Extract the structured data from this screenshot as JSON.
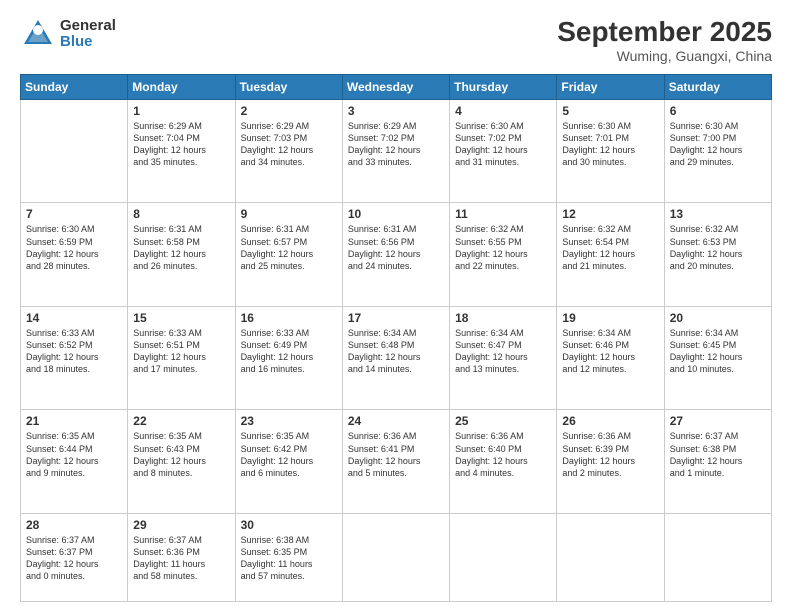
{
  "logo": {
    "general": "General",
    "blue": "Blue"
  },
  "title": {
    "month": "September 2025",
    "location": "Wuming, Guangxi, China"
  },
  "days": [
    "Sunday",
    "Monday",
    "Tuesday",
    "Wednesday",
    "Thursday",
    "Friday",
    "Saturday"
  ],
  "weeks": [
    [
      {
        "day": "",
        "info": ""
      },
      {
        "day": "1",
        "info": "Sunrise: 6:29 AM\nSunset: 7:04 PM\nDaylight: 12 hours\nand 35 minutes."
      },
      {
        "day": "2",
        "info": "Sunrise: 6:29 AM\nSunset: 7:03 PM\nDaylight: 12 hours\nand 34 minutes."
      },
      {
        "day": "3",
        "info": "Sunrise: 6:29 AM\nSunset: 7:02 PM\nDaylight: 12 hours\nand 33 minutes."
      },
      {
        "day": "4",
        "info": "Sunrise: 6:30 AM\nSunset: 7:02 PM\nDaylight: 12 hours\nand 31 minutes."
      },
      {
        "day": "5",
        "info": "Sunrise: 6:30 AM\nSunset: 7:01 PM\nDaylight: 12 hours\nand 30 minutes."
      },
      {
        "day": "6",
        "info": "Sunrise: 6:30 AM\nSunset: 7:00 PM\nDaylight: 12 hours\nand 29 minutes."
      }
    ],
    [
      {
        "day": "7",
        "info": "Sunrise: 6:30 AM\nSunset: 6:59 PM\nDaylight: 12 hours\nand 28 minutes."
      },
      {
        "day": "8",
        "info": "Sunrise: 6:31 AM\nSunset: 6:58 PM\nDaylight: 12 hours\nand 26 minutes."
      },
      {
        "day": "9",
        "info": "Sunrise: 6:31 AM\nSunset: 6:57 PM\nDaylight: 12 hours\nand 25 minutes."
      },
      {
        "day": "10",
        "info": "Sunrise: 6:31 AM\nSunset: 6:56 PM\nDaylight: 12 hours\nand 24 minutes."
      },
      {
        "day": "11",
        "info": "Sunrise: 6:32 AM\nSunset: 6:55 PM\nDaylight: 12 hours\nand 22 minutes."
      },
      {
        "day": "12",
        "info": "Sunrise: 6:32 AM\nSunset: 6:54 PM\nDaylight: 12 hours\nand 21 minutes."
      },
      {
        "day": "13",
        "info": "Sunrise: 6:32 AM\nSunset: 6:53 PM\nDaylight: 12 hours\nand 20 minutes."
      }
    ],
    [
      {
        "day": "14",
        "info": "Sunrise: 6:33 AM\nSunset: 6:52 PM\nDaylight: 12 hours\nand 18 minutes."
      },
      {
        "day": "15",
        "info": "Sunrise: 6:33 AM\nSunset: 6:51 PM\nDaylight: 12 hours\nand 17 minutes."
      },
      {
        "day": "16",
        "info": "Sunrise: 6:33 AM\nSunset: 6:49 PM\nDaylight: 12 hours\nand 16 minutes."
      },
      {
        "day": "17",
        "info": "Sunrise: 6:34 AM\nSunset: 6:48 PM\nDaylight: 12 hours\nand 14 minutes."
      },
      {
        "day": "18",
        "info": "Sunrise: 6:34 AM\nSunset: 6:47 PM\nDaylight: 12 hours\nand 13 minutes."
      },
      {
        "day": "19",
        "info": "Sunrise: 6:34 AM\nSunset: 6:46 PM\nDaylight: 12 hours\nand 12 minutes."
      },
      {
        "day": "20",
        "info": "Sunrise: 6:34 AM\nSunset: 6:45 PM\nDaylight: 12 hours\nand 10 minutes."
      }
    ],
    [
      {
        "day": "21",
        "info": "Sunrise: 6:35 AM\nSunset: 6:44 PM\nDaylight: 12 hours\nand 9 minutes."
      },
      {
        "day": "22",
        "info": "Sunrise: 6:35 AM\nSunset: 6:43 PM\nDaylight: 12 hours\nand 8 minutes."
      },
      {
        "day": "23",
        "info": "Sunrise: 6:35 AM\nSunset: 6:42 PM\nDaylight: 12 hours\nand 6 minutes."
      },
      {
        "day": "24",
        "info": "Sunrise: 6:36 AM\nSunset: 6:41 PM\nDaylight: 12 hours\nand 5 minutes."
      },
      {
        "day": "25",
        "info": "Sunrise: 6:36 AM\nSunset: 6:40 PM\nDaylight: 12 hours\nand 4 minutes."
      },
      {
        "day": "26",
        "info": "Sunrise: 6:36 AM\nSunset: 6:39 PM\nDaylight: 12 hours\nand 2 minutes."
      },
      {
        "day": "27",
        "info": "Sunrise: 6:37 AM\nSunset: 6:38 PM\nDaylight: 12 hours\nand 1 minute."
      }
    ],
    [
      {
        "day": "28",
        "info": "Sunrise: 6:37 AM\nSunset: 6:37 PM\nDaylight: 12 hours\nand 0 minutes."
      },
      {
        "day": "29",
        "info": "Sunrise: 6:37 AM\nSunset: 6:36 PM\nDaylight: 11 hours\nand 58 minutes."
      },
      {
        "day": "30",
        "info": "Sunrise: 6:38 AM\nSunset: 6:35 PM\nDaylight: 11 hours\nand 57 minutes."
      },
      {
        "day": "",
        "info": ""
      },
      {
        "day": "",
        "info": ""
      },
      {
        "day": "",
        "info": ""
      },
      {
        "day": "",
        "info": ""
      }
    ]
  ]
}
